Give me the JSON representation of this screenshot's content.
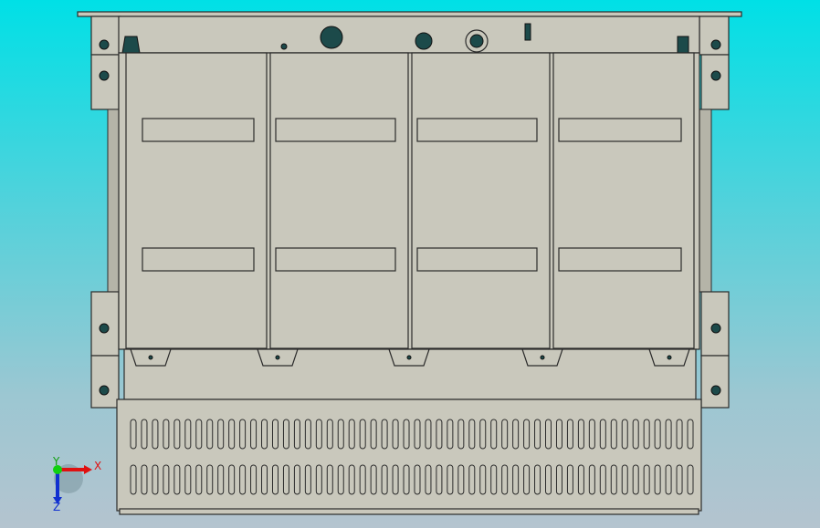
{
  "viewport": {
    "model": "cabinet-front-view"
  },
  "triad": {
    "x_label": "X",
    "y_label": "Y",
    "z_label": "Z",
    "x_color": "#e01010",
    "y_color": "#10d010",
    "z_color": "#1030d0"
  },
  "panel_count": 4,
  "vent_slots_per_row": 52
}
